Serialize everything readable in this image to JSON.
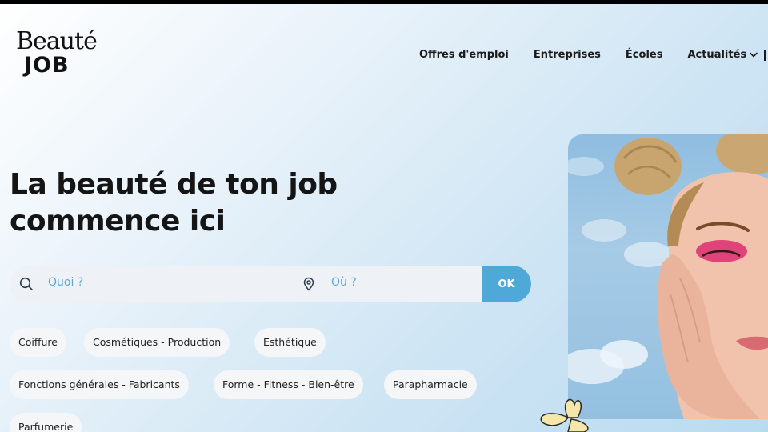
{
  "logo": {
    "script": "Beauté",
    "word": "JOB"
  },
  "nav": {
    "items": [
      {
        "label": "Offres d'emploi"
      },
      {
        "label": "Entreprises"
      },
      {
        "label": "Écoles"
      },
      {
        "label": "Actualités"
      }
    ]
  },
  "hero": {
    "line1": "La beauté de ton job",
    "line2": "commence ici"
  },
  "search": {
    "what_placeholder": "Quoi ?",
    "where_placeholder": "Où ?",
    "ok_label": "OK",
    "accent": "#4ea8d8"
  },
  "categories": [
    "Coiffure",
    "Cosmétiques - Production",
    "Esthétique",
    "Fonctions générales - Fabricants",
    "Forme - Fitness - Bien-être",
    "Parapharmacie",
    "Parfumerie"
  ]
}
